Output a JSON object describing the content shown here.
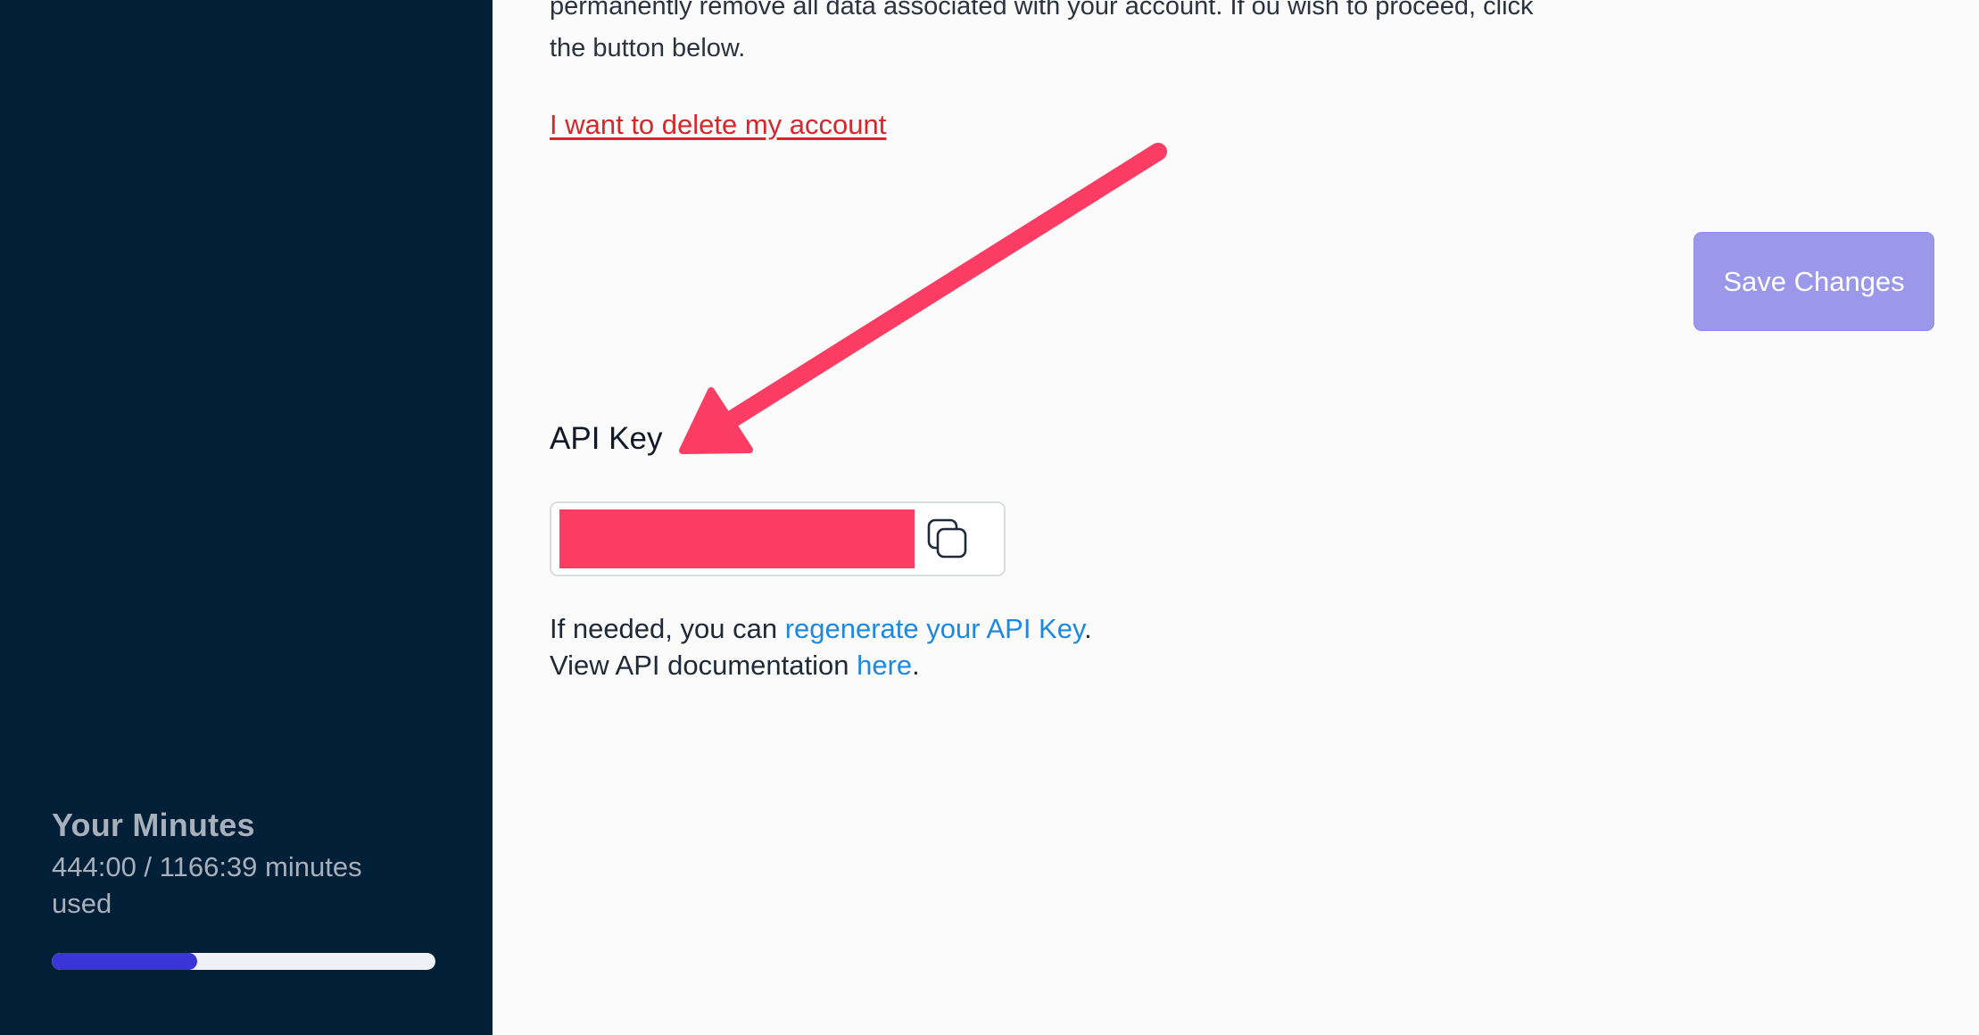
{
  "sidebar": {
    "minutes_title": "Your Minutes",
    "minutes_usage": "444:00 / 1166:39 minutes used",
    "progress_fraction": 0.38,
    "progress_color": "#3a35d6"
  },
  "account": {
    "description_line1": "permanently remove all data associated with your account. If ou wish to proceed, click",
    "description_line2": "the button below.",
    "delete_link": "I want to delete my account",
    "save_button": "Save Changes"
  },
  "api": {
    "heading": "API Key",
    "copy_icon": "copy-icon",
    "regenerate_prefix": "If needed, you can ",
    "regenerate_link": "regenerate your API Key",
    "regenerate_suffix": ".",
    "docs_prefix": "View API documentation ",
    "docs_link": "here",
    "docs_suffix": "."
  },
  "colors": {
    "sidebar_bg": "#021f38",
    "danger": "#d4282c",
    "link": "#1e88df",
    "button": "#9b98e9",
    "annotation_arrow": "#fb3d64"
  }
}
